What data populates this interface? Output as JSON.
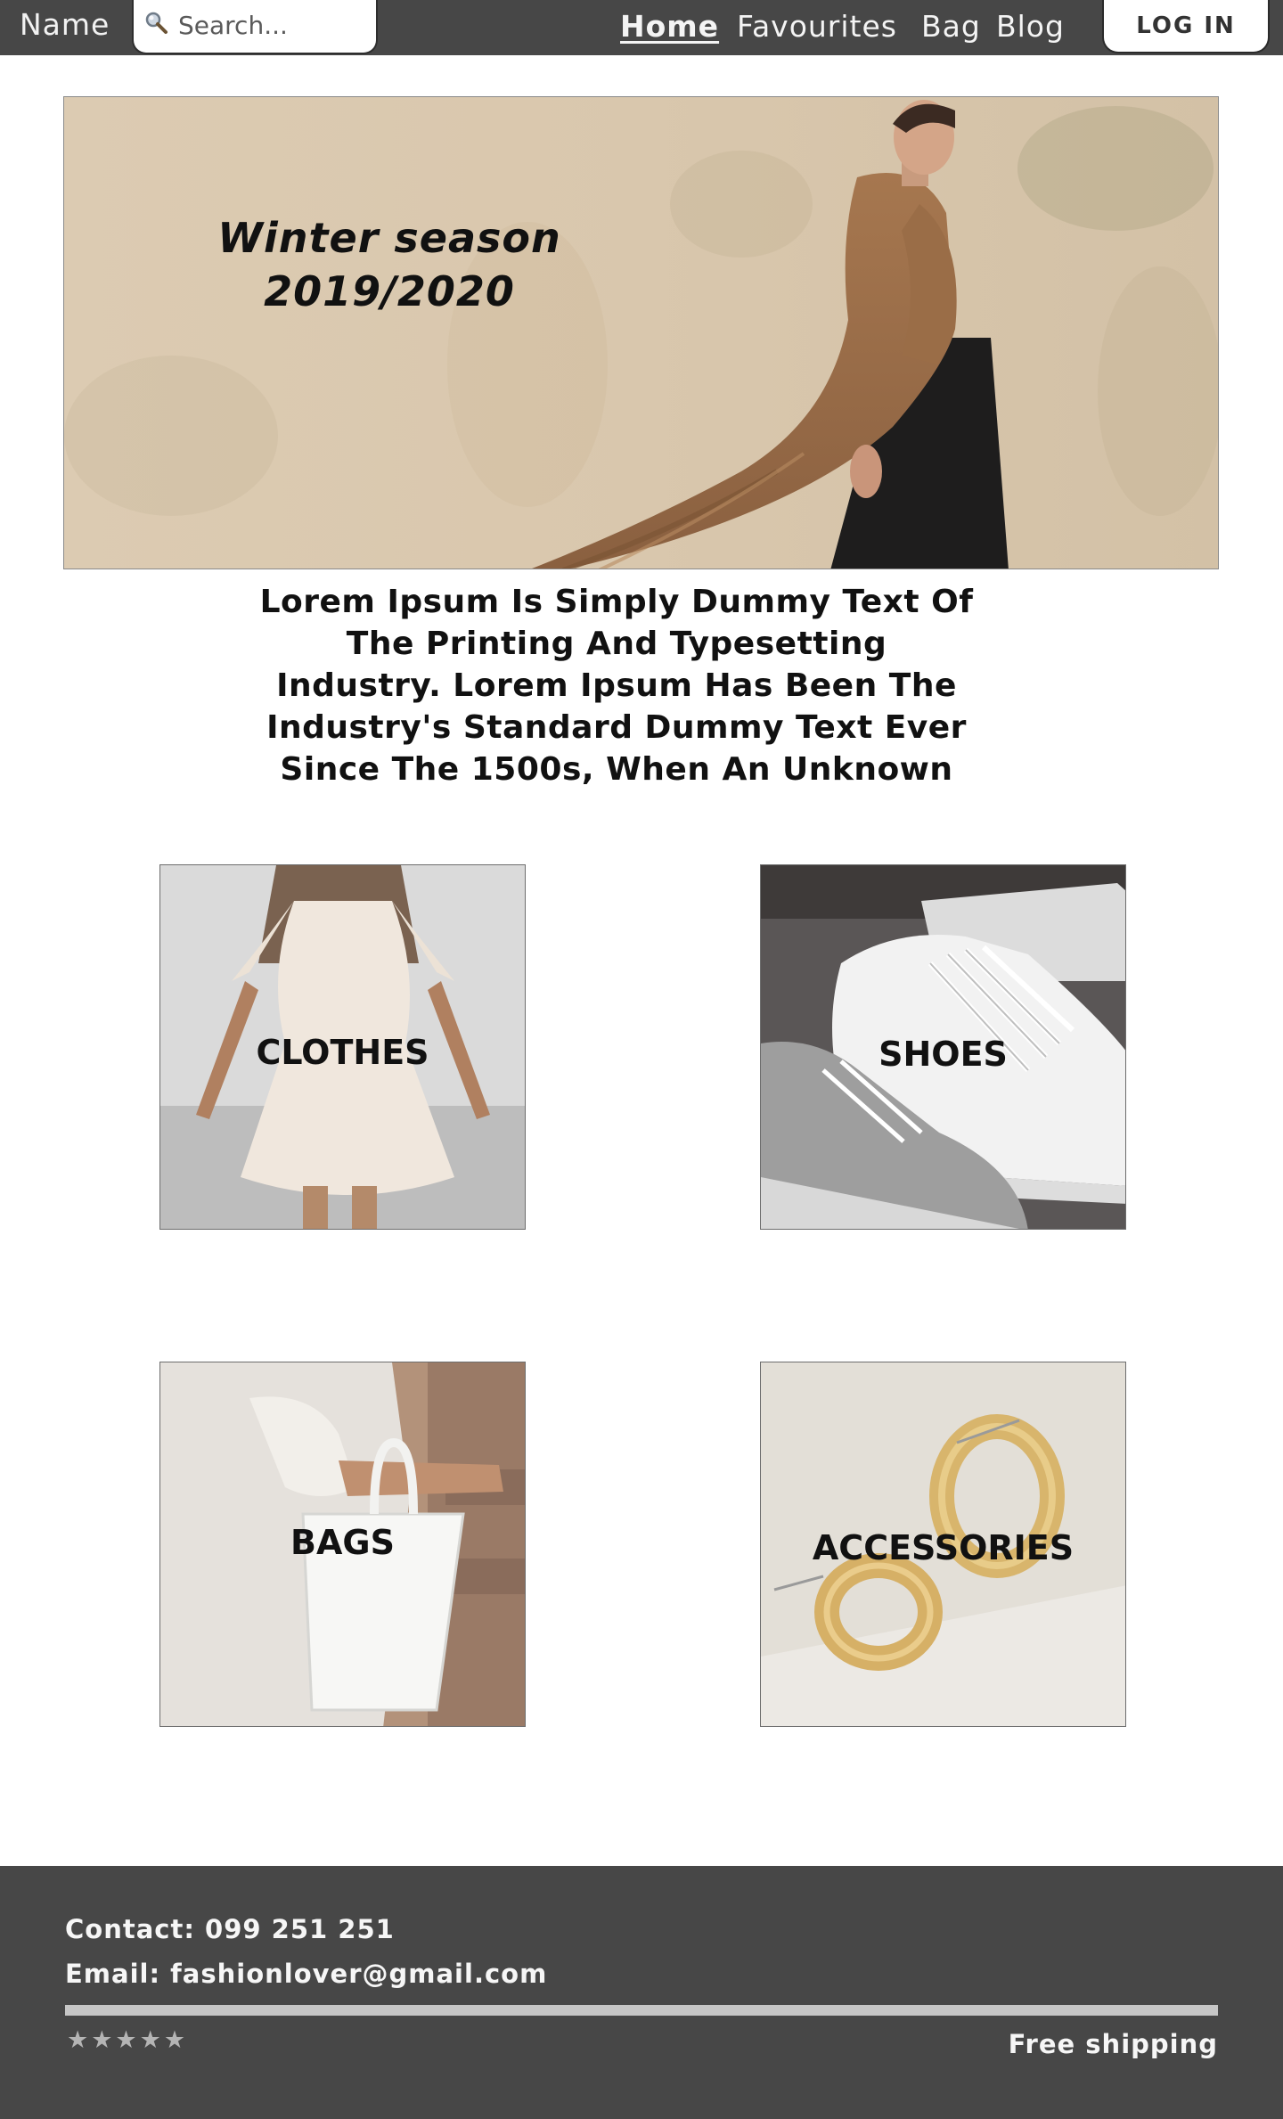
{
  "navbar": {
    "brand": "Name",
    "search_placeholder": "Search...",
    "links": [
      {
        "label": "Home",
        "active": true
      },
      {
        "label": "Favourites",
        "active": false
      },
      {
        "label": "Bag",
        "active": false
      },
      {
        "label": "Blog",
        "active": false
      }
    ],
    "login_label": "LOG IN"
  },
  "hero": {
    "title_line1": "Winter season",
    "title_line2": "2019/2020"
  },
  "intro": {
    "text": "Lorem Ipsum Is Simply Dummy Text Of The Printing And Typesetting Industry. Lorem Ipsum Has Been The Industry's Standard Dummy Text Ever Since The 1500s, When An Unknown"
  },
  "categories": [
    {
      "label": "CLOTHES"
    },
    {
      "label": "SHOES"
    },
    {
      "label": "BAGS"
    },
    {
      "label": "ACCESSORIES"
    }
  ],
  "footer": {
    "contact": "Contact: 099 251 251",
    "email": "Email: fashionlover@gmail.com",
    "rating": "★★★★★",
    "shipping": "Free shipping"
  },
  "colors": {
    "bar_background": "#474747",
    "divider": "#c6c6c6",
    "page_background": "#ffffff"
  }
}
